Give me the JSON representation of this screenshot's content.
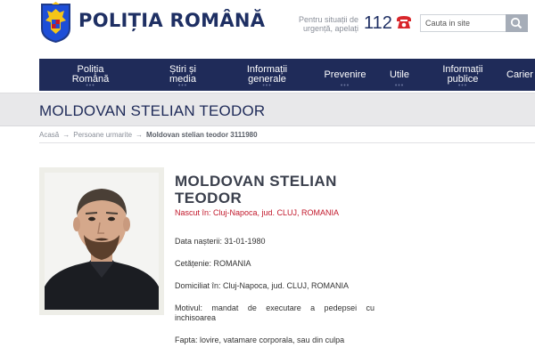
{
  "header": {
    "brand": "POLIȚIA ROMÂNĂ",
    "emergency_text": "Pentru situații de urgență, apelați",
    "emergency_number": "112",
    "search_placeholder": "Cauta in site",
    "icons": {
      "logo": "romanian-coat-of-arms",
      "phone": "phone-icon",
      "search": "search-icon"
    }
  },
  "nav": {
    "items": [
      {
        "label": "Poliția Română"
      },
      {
        "label": "Știri și media"
      },
      {
        "label": "Informații generale"
      },
      {
        "label": "Prevenire"
      },
      {
        "label": "Utile"
      },
      {
        "label": "Informații publice"
      },
      {
        "label": "Carier"
      }
    ],
    "dots": "•••"
  },
  "page": {
    "title": "MOLDOVAN STELIAN TEODOR"
  },
  "breadcrumb": {
    "home": "Acasă",
    "section": "Persoane urmarite",
    "current": "Moldovan stelian teodor 3111980",
    "separator": "→"
  },
  "person": {
    "name": "MOLDOVAN STELIAN TEODOR",
    "born": "Nascut în: Cluj-Napoca, jud. CLUJ, ROMANIA",
    "birth_date": "Data nașterii: 31-01-1980",
    "citizenship": "Cetățenie: ROMANIA",
    "domicile": "Domiciliat în: Cluj-Napoca, jud. CLUJ, ROMANIA",
    "motive": "Motivul: mandat de executare a pedepsei cu inchisoarea",
    "offense": "Fapta: lovire, vatamare corporala, sau din culpa"
  },
  "colors": {
    "navy": "#1f2b59",
    "red": "#c2182b",
    "band": "#e8e8ea"
  }
}
